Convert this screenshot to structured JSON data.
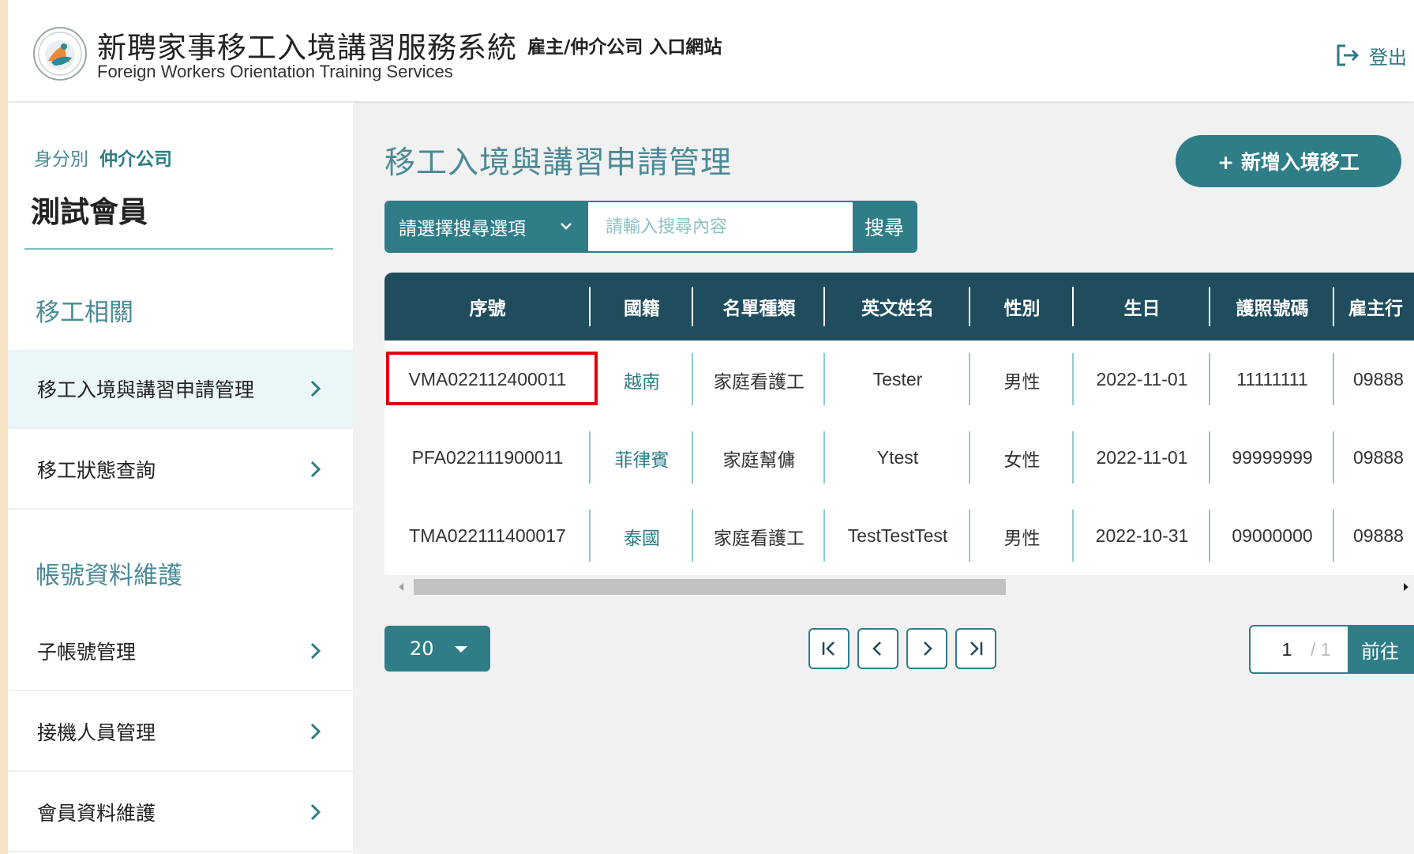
{
  "header": {
    "system_title": "新聘家事移工入境講習服務系統",
    "portal_label": "雇主/仲介公司 入口網站",
    "system_title_en": "Foreign Workers Orientation Training Services",
    "logout_label": "登出"
  },
  "sidebar": {
    "role_label": "身分別",
    "role_value": "仲介公司",
    "member_name": "測試會員",
    "section_worker": "移工相關",
    "section_account": "帳號資料維護",
    "items": [
      {
        "label": "移工入境與講習申請管理",
        "active": true
      },
      {
        "label": "移工狀態查詢",
        "active": false
      },
      {
        "label": "子帳號管理",
        "active": false
      },
      {
        "label": "接機人員管理",
        "active": false
      },
      {
        "label": "會員資料維護",
        "active": false
      }
    ]
  },
  "main": {
    "page_title": "移工入境與講習申請管理",
    "add_button": "+ 新增入境移工",
    "search": {
      "select_label": "請選擇搜尋選項",
      "placeholder": "請輸入搜尋內容",
      "button": "搜尋"
    },
    "table": {
      "headers": [
        "序號",
        "國籍",
        "名單種類",
        "英文姓名",
        "性別",
        "生日",
        "護照號碼",
        "雇主行"
      ],
      "rows": [
        [
          "VMA022112400011",
          "越南",
          "家庭看護工",
          "Tester",
          "男性",
          "2022-11-01",
          "11111111",
          "09888"
        ],
        [
          "PFA022111900011",
          "菲律賓",
          "家庭幫傭",
          "Ytest",
          "女性",
          "2022-11-01",
          "99999999",
          "09888"
        ],
        [
          "TMA022111400017",
          "泰國",
          "家庭看護工",
          "TestTestTest",
          "男性",
          "2022-10-31",
          "09000000",
          "09888"
        ]
      ]
    },
    "pagination": {
      "page_size": "20",
      "current_page": "1",
      "total_pages": "/ 1",
      "goto_button": "前往"
    }
  },
  "colors": {
    "teal": "#2e7d87",
    "header_dark": "#1f4d5e",
    "highlight": "#e0000a"
  }
}
